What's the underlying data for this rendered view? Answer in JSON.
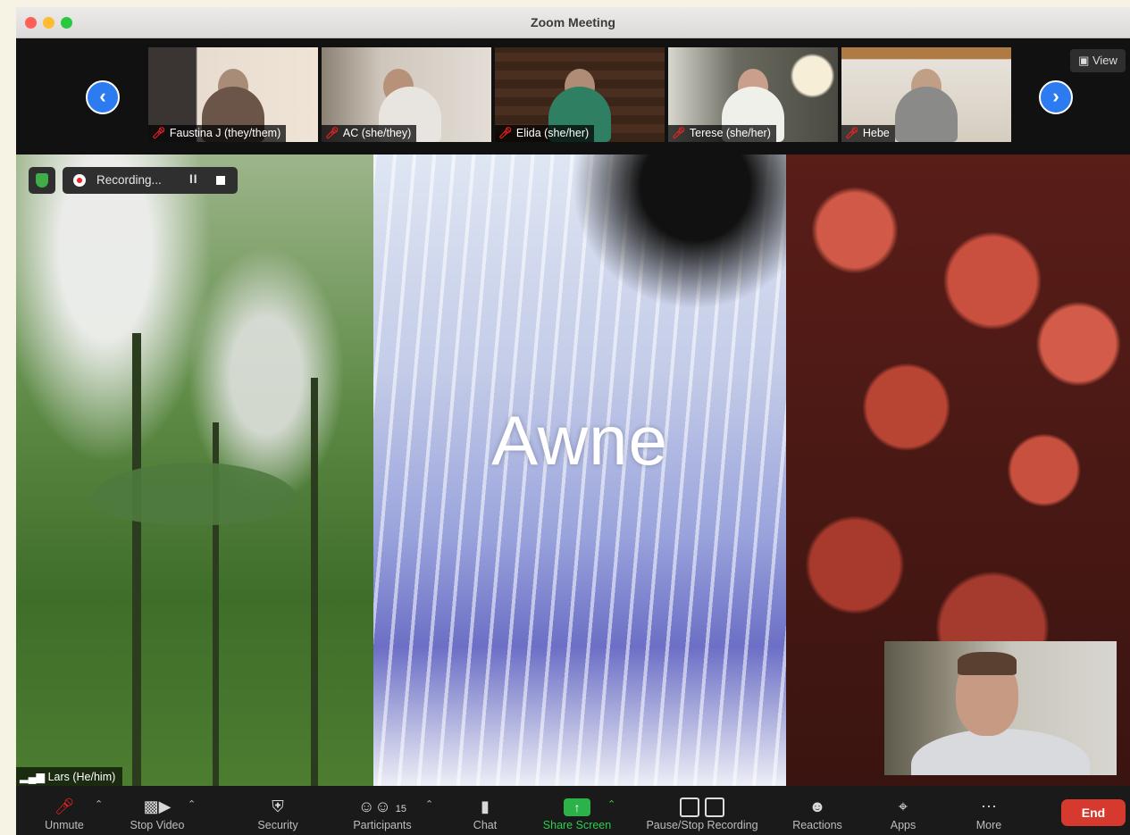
{
  "window": {
    "title": "Zoom Meeting"
  },
  "view_button": {
    "label": "View"
  },
  "thumbnails": [
    {
      "name": "Faustina J (they/them)",
      "bg": "#3a3532",
      "skin": "#a98c78",
      "shirt": "#6a5548"
    },
    {
      "name": "AC (she/they)",
      "bg": "#cfc6bb",
      "skin": "#b7917a",
      "shirt": "#e8e4e0"
    },
    {
      "name": "Elida (she/her)",
      "bg": "#3b2418",
      "skin": "#b08c76",
      "shirt": "#2f7f63"
    },
    {
      "name": "Terese (she/her)",
      "bg": "#4a4a42",
      "skin": "#caa08c",
      "shirt": "#f0f0ea"
    },
    {
      "name": "Hebe",
      "bg": "#d6cdc0",
      "skin": "#c19e86",
      "shirt": "#8a8a88"
    }
  ],
  "stage": {
    "center_text": "Awne",
    "recording_label": "Recording...",
    "pause_glyph": "II",
    "speaker_name": "Lars (He/him)"
  },
  "toolbar": {
    "unmute": "Unmute",
    "stop_video": "Stop Video",
    "security": "Security",
    "participants": "Participants",
    "participants_count": "15",
    "chat": "Chat",
    "share_screen": "Share Screen",
    "pause_stop_recording": "Pause/Stop Recording",
    "reactions": "Reactions",
    "apps": "Apps",
    "more": "More",
    "end": "End"
  },
  "colors": {
    "accent_blue": "#2d7bf0",
    "share_green": "#2bb34a",
    "end_red": "#d63a2f",
    "muted_red": "#e22222"
  }
}
